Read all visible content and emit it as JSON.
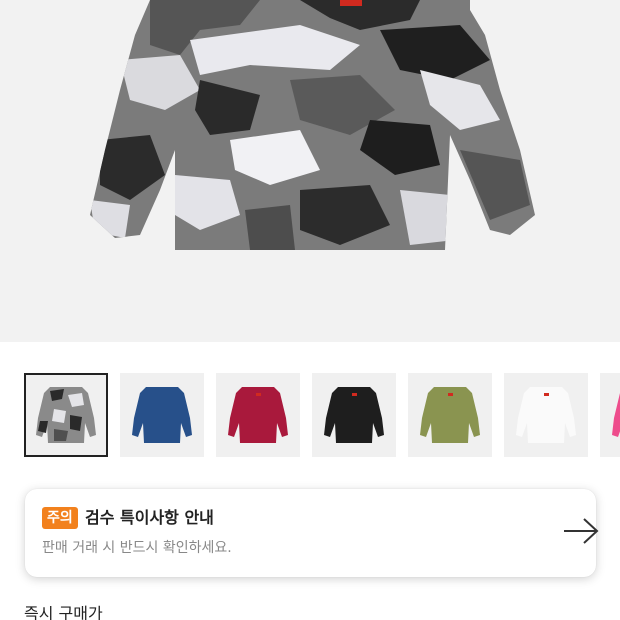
{
  "gallery": {
    "hero_alt": "camo long sleeve shirt",
    "thumbnails": [
      {
        "name": "camo",
        "color": "#8a8a8a",
        "selected": true
      },
      {
        "name": "navy",
        "color": "#27508a"
      },
      {
        "name": "burgundy",
        "color": "#a9193c"
      },
      {
        "name": "black",
        "color": "#1e1e1e"
      },
      {
        "name": "olive",
        "color": "#8a9450"
      },
      {
        "name": "white",
        "color": "#fafafa"
      },
      {
        "name": "pink",
        "color": "#ee4c8c"
      }
    ]
  },
  "notice": {
    "badge": "주의",
    "title": "검수 특이사항 안내",
    "description": "판매 거래 시 반드시 확인하세요.",
    "arrow_icon": "arrow-right-icon"
  },
  "next_section": {
    "title": "즉시 구매가"
  },
  "colors": {
    "badge": "#f2811d",
    "hero_bg": "#f2f2f2"
  }
}
